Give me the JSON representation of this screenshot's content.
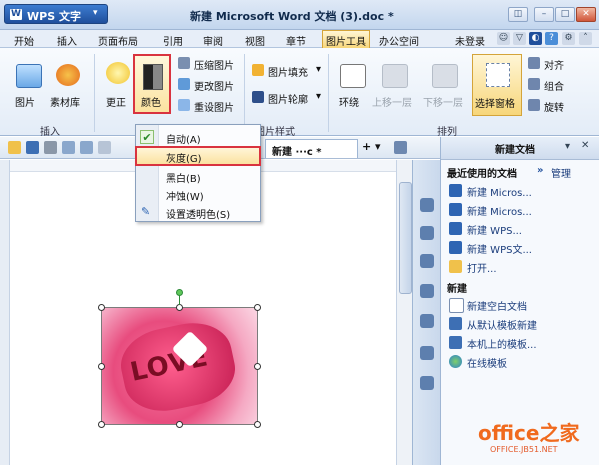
{
  "titlebar": {
    "app_button": "WPS 文字",
    "doc_title": "新建 Microsoft Word 文档 (3).doc *"
  },
  "menubar": {
    "items": [
      "开始",
      "插入",
      "页面布局",
      "引用",
      "审阅",
      "视图",
      "章节",
      "图片工具",
      "办公空间"
    ],
    "login": "未登录"
  },
  "ribbon": {
    "picture": "图片",
    "material": "素材库",
    "brightness": "更正",
    "color": "颜色",
    "compress": "压缩图片",
    "change": "更改图片",
    "reset": "重设图片",
    "fill": "图片填充",
    "outline": "图片轮廓",
    "wrap": "环绕",
    "bring_forward": "上移一层",
    "send_backward": "下移一层",
    "selection_pane": "选择窗格",
    "align": "对齐",
    "group": "组合",
    "rotate": "旋转",
    "group_insert": "插入",
    "group_style": "图片样式",
    "group_arrange": "排列"
  },
  "doctab": {
    "label": "新建 ···c *"
  },
  "dropdown": {
    "auto": "自动(A)",
    "gray": "灰度(G)",
    "bw": "黑白(B)",
    "washout": "冲蚀(W)",
    "transparent": "设置透明色(S)"
  },
  "taskpane": {
    "title": "新建文档",
    "recent_heading": "最近使用的文档",
    "manage": "管理",
    "recent": [
      "新建 Micros...",
      "新建 Micros...",
      "新建 WPS...",
      "新建 WPS文...",
      "打开..."
    ],
    "new_heading": "新建",
    "new_items": [
      "新建空白文档",
      "从默认模板新建",
      "本机上的模板...",
      "在线模板"
    ]
  },
  "image": {
    "text": "LOVE"
  },
  "watermark": {
    "brand": "office之家",
    "url": "OFFICE.JB51.NET"
  },
  "colors": {
    "accent": "#1f4f9c",
    "highlight_border": "#d9333f",
    "selected_tab": "#f7d67a"
  }
}
